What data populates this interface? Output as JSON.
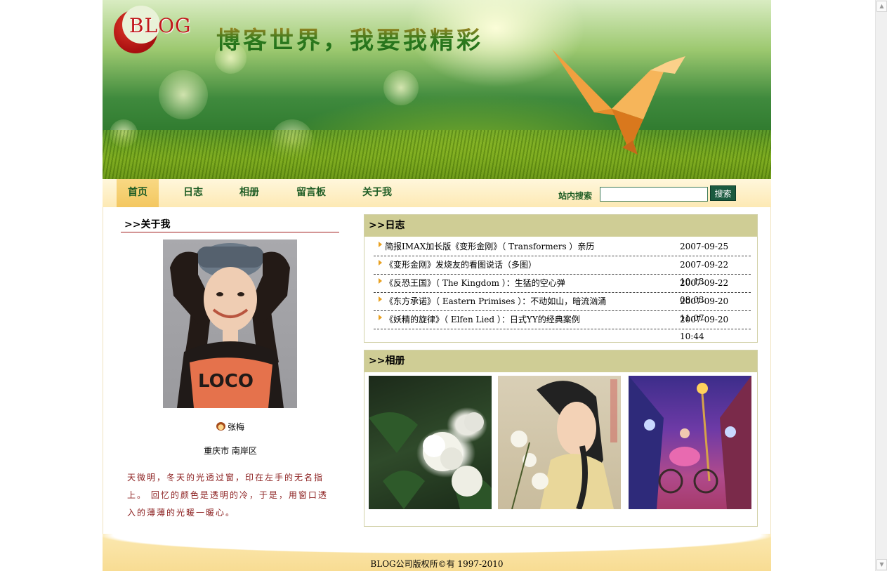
{
  "banner": {
    "logo_text": "BLOG",
    "slogan": "博客世界，我要我精彩"
  },
  "nav": {
    "items": [
      {
        "label": "首页",
        "active": true
      },
      {
        "label": "日志",
        "active": false
      },
      {
        "label": "相册",
        "active": false
      },
      {
        "label": "留言板",
        "active": false
      },
      {
        "label": "关于我",
        "active": false
      }
    ],
    "search_label": "站内搜索",
    "search_value": "",
    "search_button": "搜索"
  },
  "about": {
    "title": ">>关于我",
    "name": "张梅",
    "location": "重庆市  南岸区",
    "bio": "天微明，冬天的光透过窗，印在左手的无名指上。  回忆的颜色是透明的冷，于是，用窗口透入的薄薄的光暖一暖心。"
  },
  "diary": {
    "title": ">>日志",
    "entries": [
      {
        "title": "简报IMAX加长版《变形金刚》（ Transformers ）亲历",
        "date": "2007-09-25"
      },
      {
        "title": "《变形金刚》发烧友的看图说话（多图）",
        "date": "2007-09-22 10:13"
      },
      {
        "title": "《反恐王国》（ The Kingdom ）：生猛的空心弹",
        "date": "2007-09-22 08:03"
      },
      {
        "title": "《东方承诺》（ Eastern Primises ）：不动如山，暗流汹涌",
        "date": "2007-09-20 11:07"
      },
      {
        "title": "《妖精的旋律》（ Elfen Lied ）：日式YY的经典案例",
        "date": "2007-09-20 10:44"
      }
    ]
  },
  "album": {
    "title": ">>相册"
  },
  "footer": {
    "copyright": "BLOG公司版权所©有  1997-2010"
  },
  "colors": {
    "nav_text": "#1f5d25",
    "panel_header": "#cfcd95",
    "bio_text": "#8b1e1e",
    "search_button": "#1a5a3f"
  }
}
